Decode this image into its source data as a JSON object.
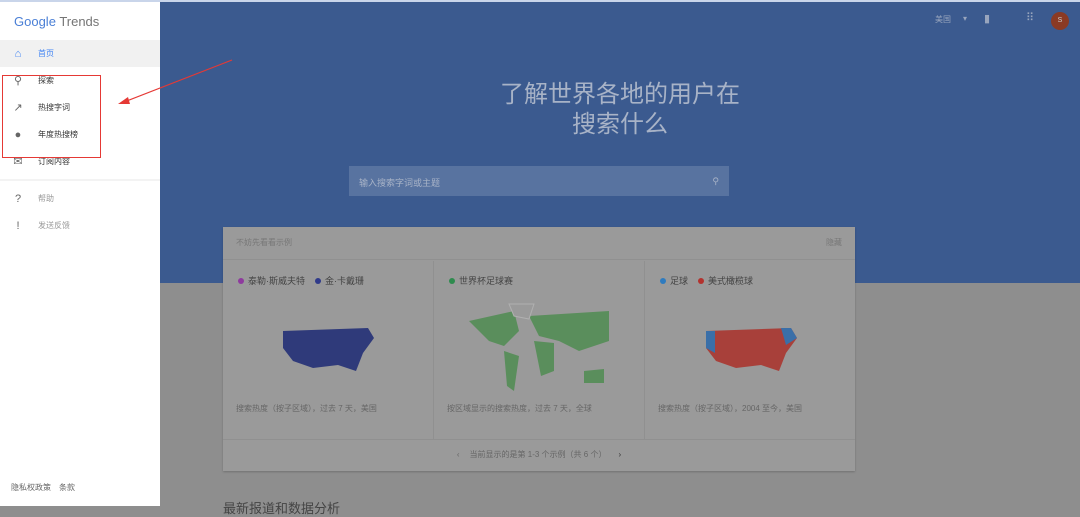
{
  "sidebar": {
    "logo_google": "Google",
    "logo_trends": "Trends",
    "items": [
      {
        "label": "首页",
        "icon": "home-icon"
      },
      {
        "label": "探索",
        "icon": "search-icon"
      },
      {
        "label": "热搜字词",
        "icon": "trending-icon"
      },
      {
        "label": "年度热搜榜",
        "icon": "globe-icon"
      },
      {
        "label": "订阅内容",
        "icon": "mail-icon"
      }
    ],
    "secondary": [
      {
        "label": "帮助",
        "icon": "help-icon"
      },
      {
        "label": "发送反馈",
        "icon": "feedback-icon"
      }
    ],
    "footer": {
      "privacy": "隐私权政策",
      "terms": "条款"
    }
  },
  "header": {
    "region": "美国",
    "avatar": "S"
  },
  "hero": {
    "title_line1": "了解世界各地的用户在",
    "title_line2": "搜索什么",
    "search_placeholder": "输入搜索字词或主题"
  },
  "examples": {
    "heading": "不妨先看看示例",
    "hide": "隐藏",
    "cards": [
      {
        "legend": [
          {
            "label": "泰勒·斯威夫特",
            "color": "#8e3a9e"
          },
          {
            "label": "金·卡戴珊",
            "color": "#2f3a8a"
          }
        ],
        "caption": "搜索热度（按子区域），过去 7 天，美国"
      },
      {
        "legend": [
          {
            "label": "世界杯足球赛",
            "color": "#2e8b4e"
          }
        ],
        "caption": "按区域显示的搜索热度，过去 7 天，全球"
      },
      {
        "legend": [
          {
            "label": "足球",
            "color": "#2e7bbf"
          },
          {
            "label": "美式橄榄球",
            "color": "#b3322e"
          }
        ],
        "caption": "搜索热度（按子区域），2004 至今，美国"
      }
    ],
    "pager": "当前显示的是第 1-3 个示例（共 6 个）"
  },
  "news_heading": "最新报道和数据分析",
  "colors": {
    "hero": "#3b5a8f",
    "annotation": "#e53935"
  }
}
